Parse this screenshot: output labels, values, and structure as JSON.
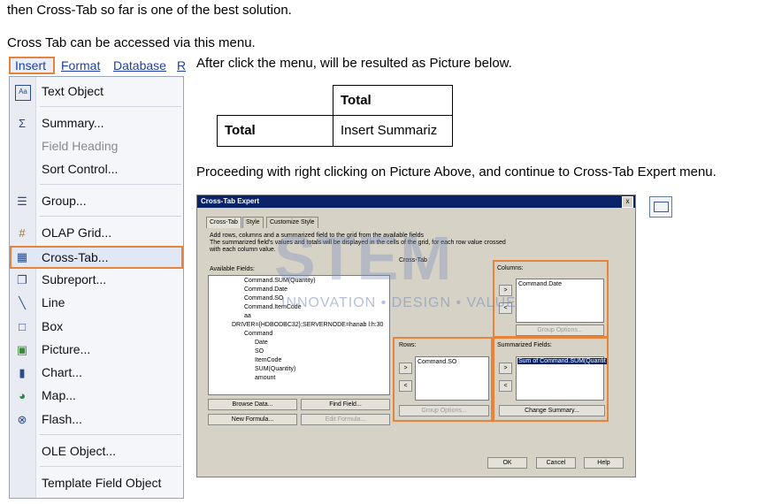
{
  "doc": {
    "line1": "then Cross-Tab so far is one of the best solution.",
    "line2": "Cross Tab can be accessed via this menu.",
    "line3": "After click the menu, will be resulted as Picture below.",
    "line4": "Proceeding with right clicking on Picture Above, and continue to Cross-Tab Expert menu."
  },
  "menubar": {
    "insert": "Insert",
    "format": "Format",
    "database": "Database",
    "r": "R"
  },
  "menu": {
    "items": [
      {
        "label": "Text Object",
        "icon": "text-object-icon"
      },
      {
        "label": "Summary...",
        "icon": "summation-icon"
      },
      {
        "label": "Field Heading",
        "icon": ""
      },
      {
        "label": "Sort Control...",
        "icon": ""
      },
      {
        "label": "Group...",
        "icon": "group-icon"
      },
      {
        "label": "OLAP Grid...",
        "icon": "olap-grid-icon"
      },
      {
        "label": "Cross-Tab...",
        "icon": "cross-tab-icon"
      },
      {
        "label": "Subreport...",
        "icon": "subreport-icon"
      },
      {
        "label": "Line",
        "icon": "line-icon"
      },
      {
        "label": "Box",
        "icon": "box-icon"
      },
      {
        "label": "Picture...",
        "icon": "picture-icon"
      },
      {
        "label": "Chart...",
        "icon": "chart-icon"
      },
      {
        "label": "Map...",
        "icon": "map-icon"
      },
      {
        "label": "Flash...",
        "icon": "flash-icon"
      },
      {
        "label": "OLE Object...",
        "icon": ""
      },
      {
        "label": "Template Field Object",
        "icon": ""
      }
    ]
  },
  "preview": {
    "total_col": "Total",
    "total_row": "Total",
    "insert_summary": "Insert Summariz"
  },
  "dialog": {
    "title": "Cross-Tab Expert",
    "close": "x",
    "tabs": [
      "Cross-Tab",
      "Style",
      "Customize Style"
    ],
    "desc1": "Add rows, columns and a summarized field to the grid from the available fields",
    "desc2": "The summarized field's values and totals will be displayed in the cells of the grid, for each row value crossed",
    "desc3": "with each column value.",
    "available_label": "Available Fields:",
    "crosstab_label": "Cross-Tab",
    "columns_label": "Columns:",
    "rows_label": "Rows:",
    "summarized_label": "Summarized Fields:",
    "fields": [
      "Command.SUM(Quantity)",
      "Command.Date",
      "Command.SO",
      "Command.ItemCode",
      "aa",
      "DRIVER={HDBODBC32};SERVERNODE=hanab l:h:30",
      "Command",
      "Date",
      "SO",
      "ItemCode",
      "SUM(Quantity)",
      "amount"
    ],
    "columns_value": "Command.Date",
    "rows_value": "Command.SO",
    "summarized_value": "Sum of Command.SUM(Quantit",
    "browse": "Browse Data...",
    "find": "Find Field...",
    "new_formula": "New Formula...",
    "edit_formula": "Edit Formula...",
    "group_options": "Group Options...",
    "change_summary": "Change Summary...",
    "ok": "OK",
    "cancel": "Cancel",
    "help": "Help"
  },
  "watermark": {
    "big": "STEM",
    "small": "INNOVATION • DESIGN • VALUE"
  },
  "colors": {
    "highlight": "#e8833a",
    "menu_text": "#1f3f9f",
    "title_bar": "#0a246a"
  }
}
